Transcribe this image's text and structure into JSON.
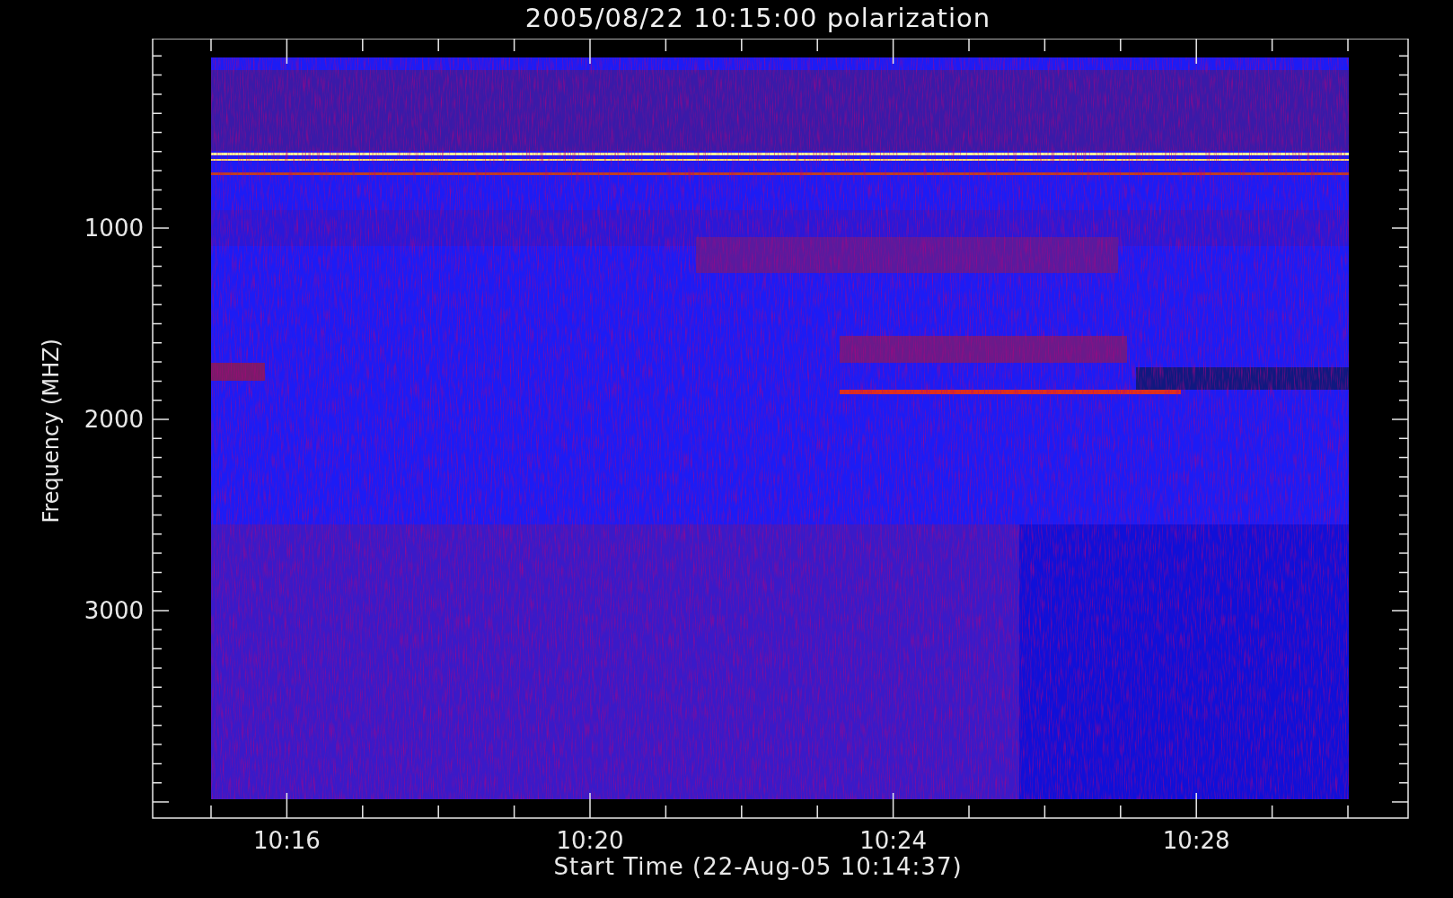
{
  "title": "2005/08/22 10:15:00 polarization",
  "y_axis": {
    "label": "Frequency (MHZ)",
    "ticks": [
      "1000",
      "2000",
      "3000"
    ]
  },
  "x_axis": {
    "label": "Start Time (22-Aug-05 10:14:37)",
    "ticks": [
      "10:16",
      "10:20",
      "10:24",
      "10:28"
    ]
  }
}
